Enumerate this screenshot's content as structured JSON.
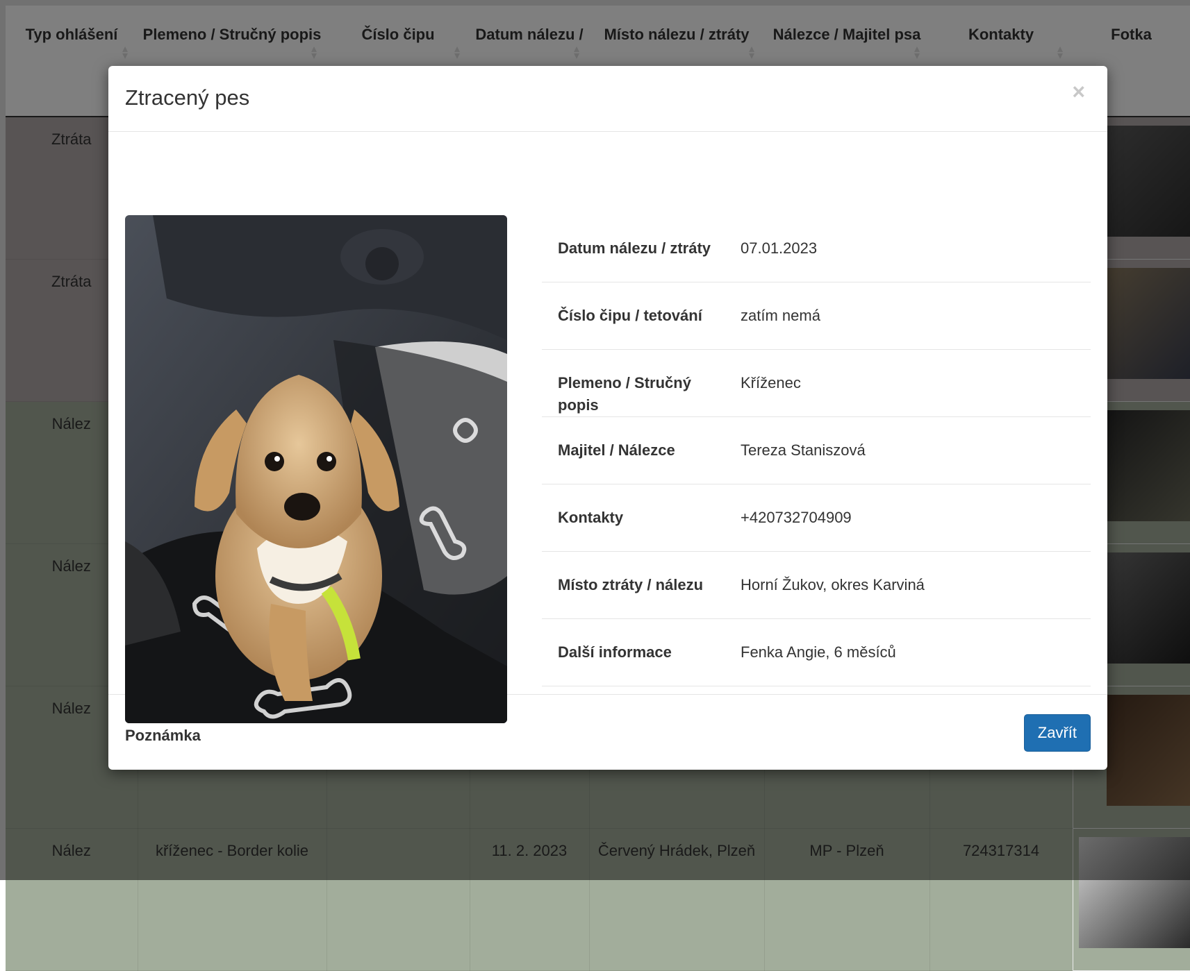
{
  "table": {
    "headers": [
      "Typ ohlášení",
      "Plemeno / Stručný popis",
      "Číslo čipu",
      "Datum nálezu /",
      "Místo nálezu / ztráty",
      "Nálezce / Majitel psa",
      "Kontakty",
      "Fotka"
    ],
    "rows": [
      {
        "type": "Ztráta",
        "desc": "",
        "date": "",
        "place": "",
        "owner": "",
        "contact": ""
      },
      {
        "type": "Ztráta",
        "desc": "",
        "date": "",
        "place": "",
        "owner": "",
        "contact": ""
      },
      {
        "type": "Nález",
        "desc": "",
        "date": "",
        "place": "",
        "owner": "",
        "contact": ""
      },
      {
        "type": "Nález",
        "desc": "",
        "date": "",
        "place": "",
        "owner": "",
        "contact": ""
      },
      {
        "type": "Nález",
        "desc": "",
        "date": "",
        "place": "",
        "owner": "",
        "contact": ""
      },
      {
        "type": "Nález",
        "desc": "kříženec - Border kolie",
        "date": "11. 2. 2023",
        "place": "Červený Hrádek, Plzeň",
        "owner": "MP - Plzeň",
        "contact": "724317314"
      }
    ]
  },
  "modal": {
    "title": "Ztracený pes",
    "close_symbol": "×",
    "note_label": "Poznámka",
    "footer_button": "Zavřít",
    "details": [
      {
        "label": "Datum nálezu / ztráty",
        "value": "07.01.2023"
      },
      {
        "label": "Číslo čipu / tetování",
        "value": "zatím nemá"
      },
      {
        "label": "Plemeno / Stručný popis",
        "value": "Kříženec"
      },
      {
        "label": "Majitel / Nálezce",
        "value": "Tereza Staniszová"
      },
      {
        "label": "Kontakty",
        "value": "+420732704909"
      },
      {
        "label": "Místo ztráty / nálezu",
        "value": "Horní Žukov, okres Karviná"
      },
      {
        "label": "Další informace",
        "value": "Fenka Angie, 6 měsíců"
      }
    ]
  },
  "colors": {
    "ztrata_row": "#b0a8a9",
    "nalez_row": "#a2ad9b",
    "primary_button": "#1f6fb2"
  },
  "icons": {
    "sort": "sort-icon",
    "close": "close-icon"
  }
}
